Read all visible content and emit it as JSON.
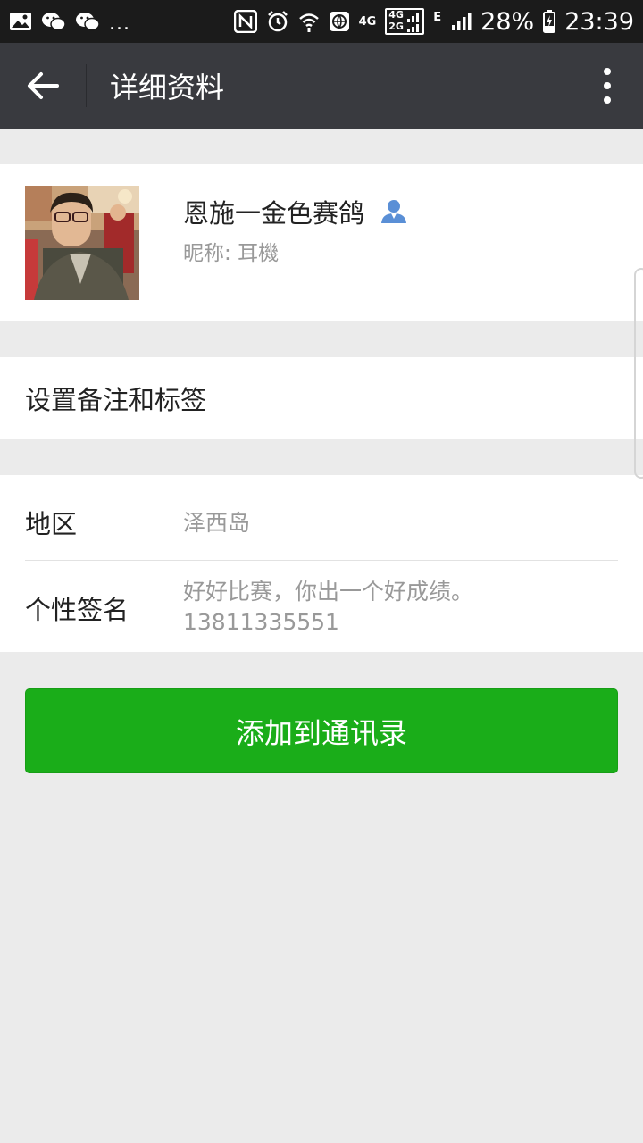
{
  "status_bar": {
    "dots": "...",
    "net_4g_label": "4G",
    "net_4g2g_top": "4G",
    "net_4g2g_bottom": "2G",
    "net_e_label": "E",
    "battery_percent": "28%",
    "time": "23:39"
  },
  "app_bar": {
    "title": "详细资料"
  },
  "profile": {
    "display_name": "恩施一金色赛鸽",
    "nickname_label": "昵称: ",
    "nickname": "耳機"
  },
  "remarks": {
    "label": "设置备注和标签"
  },
  "info": {
    "region_label": "地区",
    "region_value": "泽西岛",
    "signature_label": "个性签名",
    "signature_line1": "好好比赛，你出一个好成绩。",
    "signature_line2": "13811335551"
  },
  "actions": {
    "add_contact_label": "添加到通讯录"
  },
  "colors": {
    "status_bar_bg": "#1b1b1b",
    "app_bar_bg": "#393a3f",
    "page_bg": "#ebebeb",
    "primary_button": "#1aad19",
    "contact_icon": "#5a8fd6"
  }
}
